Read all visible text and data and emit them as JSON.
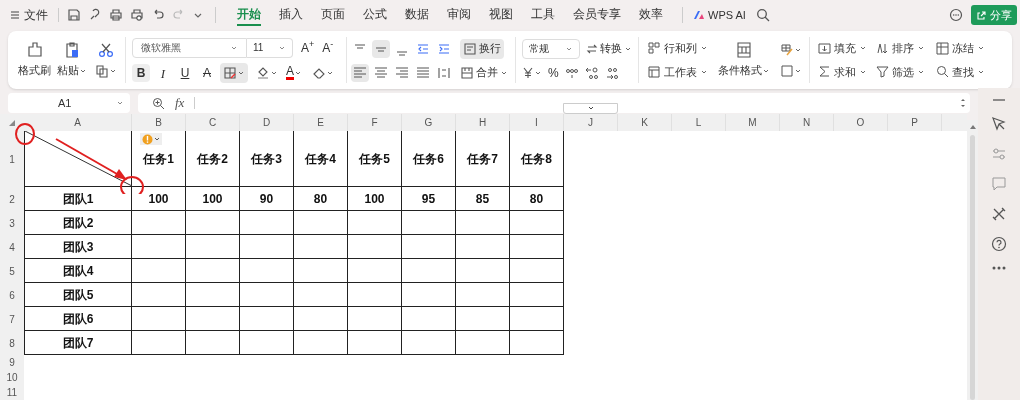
{
  "menu_bar": {
    "file_menu": "文件",
    "tabs": [
      {
        "label": "开始",
        "selected": true
      },
      {
        "label": "插入",
        "selected": false
      },
      {
        "label": "页面",
        "selected": false
      },
      {
        "label": "公式",
        "selected": false
      },
      {
        "label": "数据",
        "selected": false
      },
      {
        "label": "审阅",
        "selected": false
      },
      {
        "label": "视图",
        "selected": false
      },
      {
        "label": "工具",
        "selected": false
      },
      {
        "label": "会员专享",
        "selected": false
      },
      {
        "label": "效率",
        "selected": false
      }
    ],
    "ai_button": "WPS AI",
    "share_button": "分享"
  },
  "ribbon": {
    "format_painter": "格式刷",
    "paste": "粘贴",
    "font_family": "微软雅黑",
    "font_size": "11",
    "grow_font": "A$^{+}$",
    "shrink_font": "A$^{-}$",
    "bold": "B",
    "italic": "I",
    "underline": "U",
    "strikethrough": "A",
    "font_color": "A",
    "borders": {
      "on": true
    },
    "valign_buttons": [
      {
        "on": false
      },
      {
        "on": true
      },
      {
        "on": false
      }
    ],
    "halign_buttons": [
      {
        "on": true
      },
      {
        "on": false
      },
      {
        "on": false
      },
      {
        "on": false
      }
    ],
    "wrap_text": {
      "label": "换行",
      "on": true
    },
    "merge": "合并",
    "number_format": "常规",
    "convert": "转换",
    "percent": "%",
    "rows_cols": "行和列",
    "worksheet": "工作表",
    "conditional_format": "条件格式",
    "fill": "填充",
    "sort": "排序",
    "freeze": "冻结",
    "sum": "求和",
    "filter": "筛选",
    "find": "查找"
  },
  "formula_bar": {
    "name_box": "A1",
    "fx": "fx"
  },
  "sheet": {
    "columns": [
      "A",
      "B",
      "C",
      "D",
      "E",
      "F",
      "G",
      "H",
      "I",
      "J",
      "K",
      "L",
      "M",
      "N",
      "O",
      "P"
    ],
    "rows": [
      "1",
      "2",
      "3",
      "4",
      "5",
      "6",
      "7",
      "8",
      "9",
      "10",
      "11"
    ],
    "task_headers": [
      "任务1",
      "任务2",
      "任务3",
      "任务4",
      "任务5",
      "任务6",
      "任务7",
      "任务8"
    ],
    "teams": [
      {
        "label": "团队1",
        "values": [
          "100",
          "100",
          "90",
          "80",
          "100",
          "95",
          "85",
          "80"
        ]
      },
      {
        "label": "团队2"
      },
      {
        "label": "团队3"
      },
      {
        "label": "团队4"
      },
      {
        "label": "团队5"
      },
      {
        "label": "团队6"
      },
      {
        "label": "团队7"
      }
    ]
  }
}
